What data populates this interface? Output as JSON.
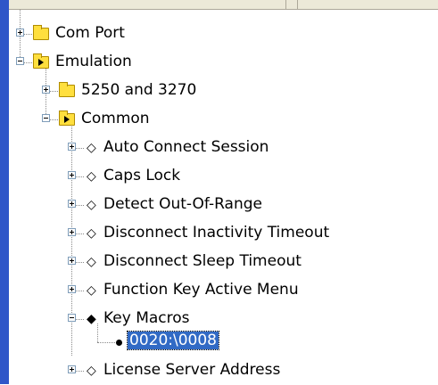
{
  "tree": {
    "nodes": [
      {
        "label": "Com Port",
        "icon": "folder-closed-icon",
        "expander": "plus",
        "level": 0
      },
      {
        "label": "Emulation",
        "icon": "folder-open-icon",
        "expander": "minus",
        "level": 0
      },
      {
        "label": "5250 and 3270",
        "icon": "folder-closed-icon",
        "expander": "plus",
        "level": 1
      },
      {
        "label": "Common",
        "icon": "folder-open-icon",
        "expander": "minus",
        "level": 1
      },
      {
        "label": "Auto Connect Session",
        "icon": "setting-diamond-icon",
        "expander": "plus",
        "level": 2
      },
      {
        "label": "Caps Lock",
        "icon": "setting-diamond-icon",
        "expander": "plus",
        "level": 2
      },
      {
        "label": "Detect Out-Of-Range",
        "icon": "setting-diamond-icon",
        "expander": "plus",
        "level": 2
      },
      {
        "label": "Disconnect Inactivity Timeout",
        "icon": "setting-diamond-icon",
        "expander": "plus",
        "level": 2
      },
      {
        "label": "Disconnect Sleep Timeout",
        "icon": "setting-diamond-icon",
        "expander": "plus",
        "level": 2
      },
      {
        "label": "Function Key Active Menu",
        "icon": "setting-diamond-icon",
        "expander": "plus",
        "level": 2
      },
      {
        "label": "Key Macros",
        "icon": "setting-diamond-filled-icon",
        "expander": "minus",
        "level": 2
      },
      {
        "label": "0020:\\0008",
        "icon": "value-bullet-icon",
        "expander": "none",
        "level": 3,
        "selected": true
      },
      {
        "label": "License Server Address",
        "icon": "setting-diamond-icon",
        "expander": "plus",
        "level": 2
      }
    ]
  },
  "colors": {
    "selection": "#316ac5",
    "folder": "#ffdf3e",
    "window_edge": "#2f56c8"
  }
}
